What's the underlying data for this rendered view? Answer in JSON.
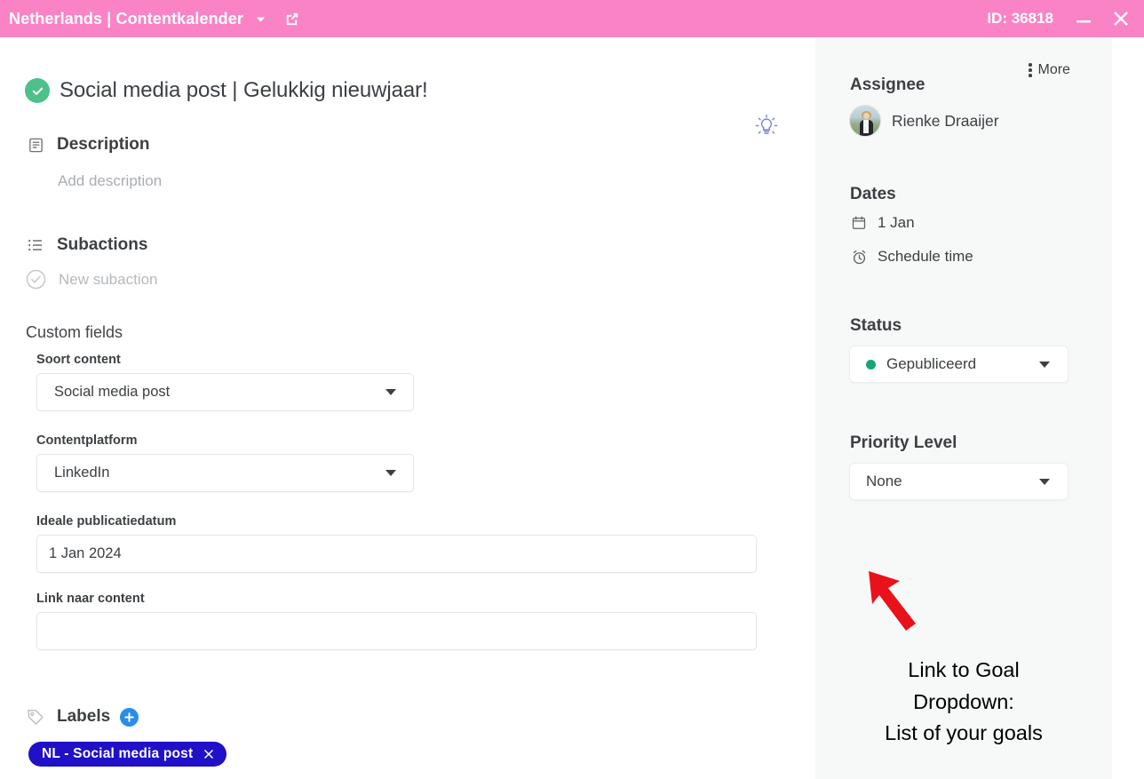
{
  "titlebar": {
    "title": "Netherlands | Contentkalender",
    "caret_icon": "chevron-down-icon",
    "external_link_icon": "external-link-icon",
    "id_label": "ID: 36818",
    "minimize_icon": "minimize-icon",
    "close_icon": "close-icon",
    "background_color": "#fa83c6"
  },
  "main": {
    "task": {
      "status_icon": "check-circle-filled-icon",
      "status_color": "#4ec08a",
      "title": "Social media post | Gelukkig nieuwjaar!",
      "tip_icon": "lightbulb-icon",
      "tip_icon_color": "#7b7fd4"
    },
    "description": {
      "icon": "description-icon",
      "heading": "Description",
      "placeholder": "Add description"
    },
    "subactions": {
      "icon": "list-icon",
      "heading": "Subactions",
      "new_item_icon": "check-circle-outline-icon",
      "new_item_label": "New subaction"
    },
    "custom_fields": {
      "heading": "Custom fields",
      "fields": [
        {
          "label": "Soort content",
          "type": "select",
          "value": "Social media post",
          "caret_icon": "caret-down-icon"
        },
        {
          "label": "Contentplatform",
          "type": "select",
          "value": "LinkedIn",
          "caret_icon": "caret-down-icon"
        },
        {
          "label": "Ideale publicatiedatum",
          "type": "text",
          "value": "1 Jan 2024"
        },
        {
          "label": "Link naar content",
          "type": "text",
          "value": ""
        }
      ]
    },
    "labels": {
      "icon": "tag-icon",
      "heading": "Labels",
      "add_icon": "plus-circle-icon",
      "add_icon_color": "#2b8ced",
      "items": [
        {
          "text": "NL - Social media post",
          "color": "#2010c8",
          "remove_icon": "close-icon"
        }
      ]
    },
    "scrollbar": {
      "name": "vertical-scrollbar"
    }
  },
  "sidebar": {
    "more": {
      "icon": "more-vertical-icon",
      "label": "More"
    },
    "assignee": {
      "heading": "Assignee",
      "avatar_icon": "user-avatar",
      "name": "Rienke Draaijer"
    },
    "dates": {
      "heading": "Dates",
      "date": {
        "icon": "calendar-icon",
        "label": "1 Jan"
      },
      "time": {
        "icon": "alarm-clock-icon",
        "label": "Schedule time"
      }
    },
    "status": {
      "heading": "Status",
      "value": "Gepubliceerd",
      "dot_color": "#17a673",
      "caret_icon": "caret-down-icon"
    },
    "priority": {
      "heading": "Priority Level",
      "value": "None",
      "caret_icon": "caret-down-icon"
    },
    "annotation": {
      "arrow_icon": "red-arrow-icon",
      "arrow_color": "#e8121a",
      "line1": "Link to Goal",
      "line2": "Dropdown:",
      "line3": "List of your goals"
    }
  }
}
